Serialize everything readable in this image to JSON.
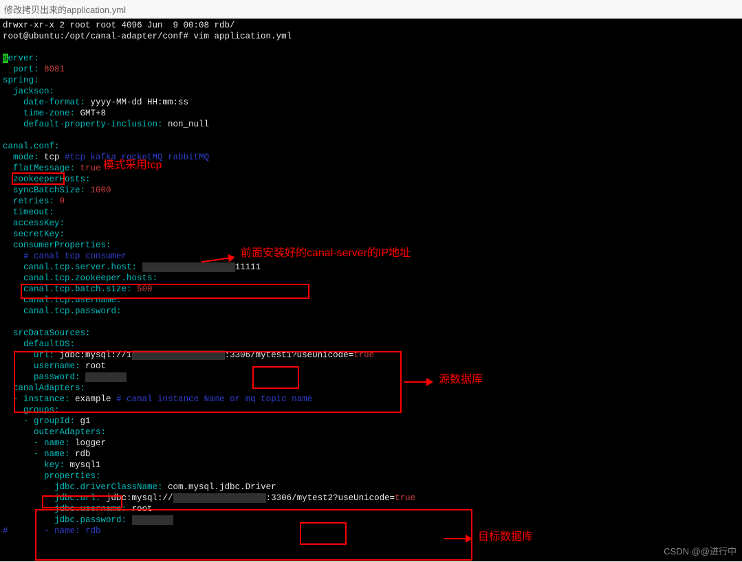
{
  "page_title": "修改拷贝出来的application.yml",
  "prompt_line": "root@ubuntu:/opt/canal-adapter/conf# vim application.yml",
  "ls_line": "drwxr-xr-x 2 root root 4096 Jun  9 00:08 rdb/",
  "yaml": {
    "server": "server:",
    "port_key": "  port: ",
    "port_val": "8081",
    "spring": "spring:",
    "jackson": "  jackson:",
    "date_format_k": "    date-format: ",
    "date_format_v": "yyyy-MM-dd HH:mm:ss",
    "time_zone_k": "    time-zone: ",
    "time_zone_v": "GMT+8",
    "dpi_k": "    default-property-inclusion: ",
    "dpi_v": "non_null",
    "canal_conf": "canal.conf:",
    "mode_k": "  mode: ",
    "mode_v": "tcp ",
    "mode_comment": "#tcp kafka rocketMQ rabbitMQ",
    "flat_k": "  flatMessage: ",
    "flat_v": "true",
    "zk_hosts": "  zookeeperHosts:",
    "sync_k": "  syncBatchSize: ",
    "sync_v": "1000",
    "retries_k": "  retries: ",
    "retries_v": "0",
    "timeout": "  timeout:",
    "accesskey": "  accessKey:",
    "secretkey": "  secretKey:",
    "consumer": "  consumerProperties:",
    "tcp_comment": "    # canal tcp consumer",
    "tcp_host_k": "    canal.tcp.server.host: ",
    "tcp_host_v": "11111",
    "tcp_zk": "    canal.tcp.zookeeper.hosts:",
    "tcp_batch_k": "    canal.tcp.batch.size: ",
    "tcp_batch_v": "500",
    "tcp_user": "    canal.tcp.username:",
    "tcp_pass": "    canal.tcp.password:",
    "src_ds": "  srcDataSources:",
    "default_ds": "    defaultDS:",
    "url_k": "      url: ",
    "url_v1": "jdbc:mysql://1",
    "url_v2": ":3306/",
    "url_v3": "mytest1",
    "url_v4": "?useUnicode=",
    "url_true": "true",
    "username_k": "      username: ",
    "username_v": "root",
    "password_k": "      password: ",
    "canal_adapters": "  canalAdapters:",
    "instance_k": "  - instance: ",
    "instance_v": "example ",
    "instance_c": "# canal instance Name or mq topic name",
    "groups": "    groups:",
    "groupid_k": "    - groupId: ",
    "groupid_v": "g1",
    "outer": "      outerAdapters:",
    "name1_k": "      - name: ",
    "name1_v": "logger",
    "name2_k": "      - name: ",
    "name2_v": "rdb",
    "key_k": "        key: ",
    "key_v": "mysql1",
    "properties": "        properties:",
    "driver_k": "          jdbc.driverClassName: ",
    "driver_v": "com.mysql.jdbc.Driver",
    "jdbcurl_k": "          jdbc.url: ",
    "jdbcurl_v1": "jdbc:mysql://",
    "jdbcurl_v2": ":3306/",
    "jdbcurl_v3": "mytest2",
    "jdbcurl_v4": "?useUnicode=",
    "jdbcuser_k": "          jdbc.username: ",
    "jdbcuser_v": "root",
    "jdbcpass_k": "          jdbc.password: ",
    "name3": "#       - name: rdb"
  },
  "annotations": {
    "mode_label": "模式采用tcp",
    "server_label": "前面安装好的canal-server的IP地址",
    "src_db_label": "源数据库",
    "target_db_label": "目标数据库"
  },
  "watermark": "CSDN @@进行中"
}
